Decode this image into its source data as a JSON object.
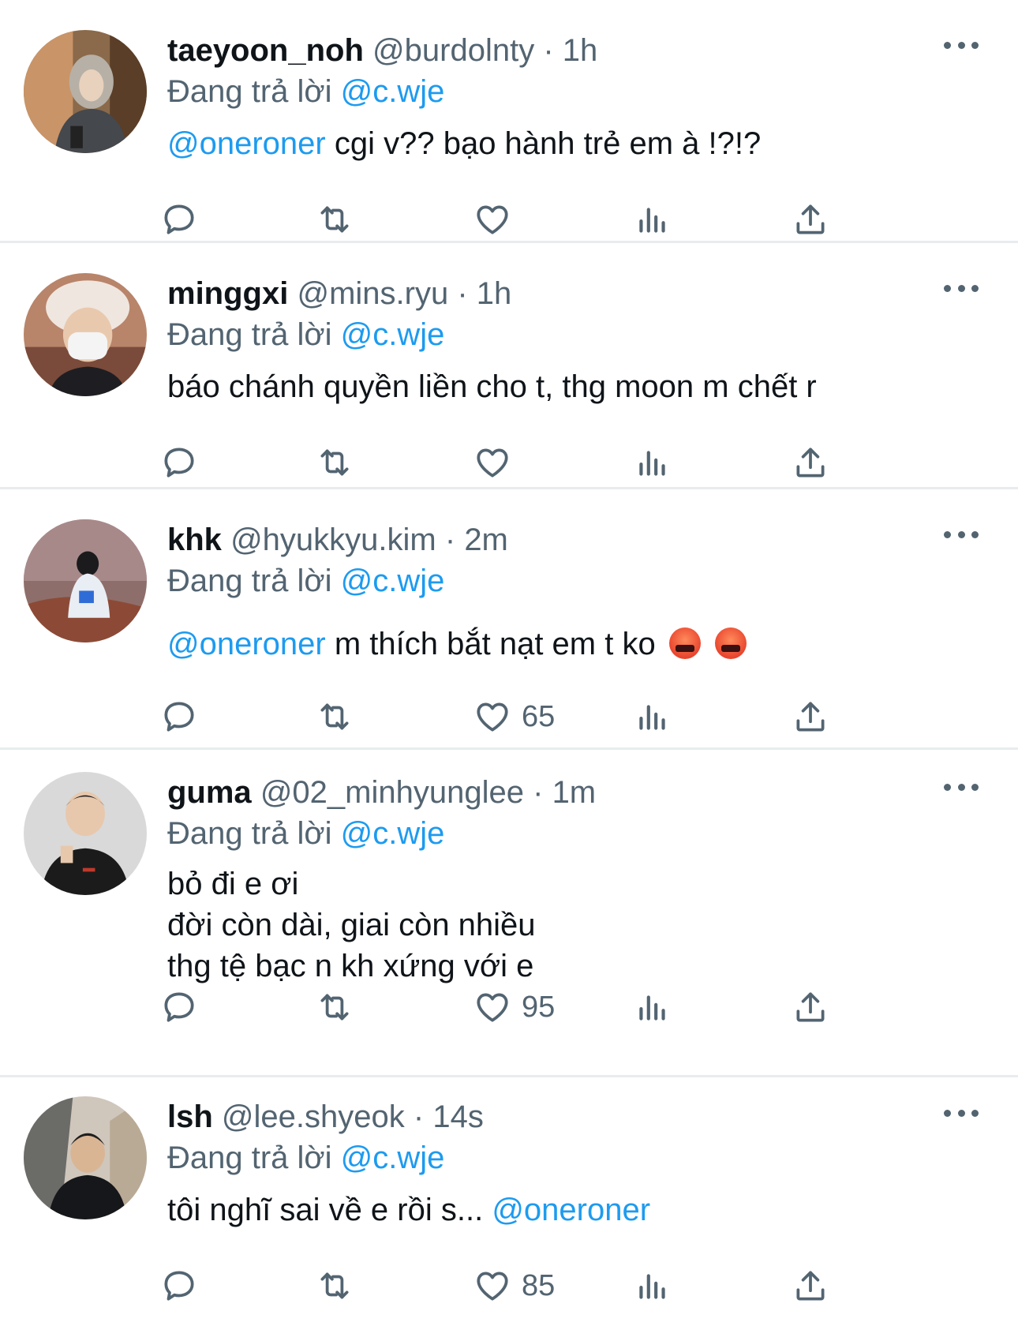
{
  "reply_prefix": "Đang trả lời",
  "tweets": [
    {
      "name": "taeyoon_noh",
      "handle": "@burdolnty",
      "separator": "·",
      "time": "1h",
      "reply_to": "@c.wje",
      "mention": "@oneroner",
      "text": " cgi v?? bạo hành trẻ em à !?!?",
      "likes": ""
    },
    {
      "name": "minggxi",
      "handle": "@mins.ryu",
      "separator": "·",
      "time": "1h",
      "reply_to": "@c.wje",
      "text": "báo chánh quyền liền cho t, thg moon m chết r",
      "likes": ""
    },
    {
      "name": "khk",
      "handle": "@hyukkyu.kim",
      "separator": "·",
      "time": "2m",
      "reply_to": "@c.wje",
      "mention": "@oneroner",
      "text": " m thích bắt nạt em t ko ",
      "emoji_name": "face-with-symbols-on-mouth",
      "likes": "65"
    },
    {
      "name": "guma",
      "handle": "@02_minhyunglee",
      "separator": "·",
      "time": "1m",
      "reply_to": "@c.wje",
      "lines": [
        "bỏ đi e ơi",
        "đời còn dài, giai còn nhiều",
        "thg tệ bạc n kh xứng với e"
      ],
      "likes": "95"
    },
    {
      "name": "lsh",
      "handle": "@lee.shyeok",
      "separator": "·",
      "time": "14s",
      "reply_to": "@c.wje",
      "text": "tôi nghĩ sai về e rồi s... ",
      "mention_after": "@oneroner",
      "likes": "85"
    }
  ],
  "icons": {
    "reply": "reply-icon",
    "retweet": "retweet-icon",
    "like": "heart-icon",
    "views": "views-icon",
    "share": "share-icon",
    "more": "more-icon"
  },
  "colors": {
    "mention": "#1d9bf0",
    "secondary": "#536471",
    "divider": "#e8ecef"
  }
}
